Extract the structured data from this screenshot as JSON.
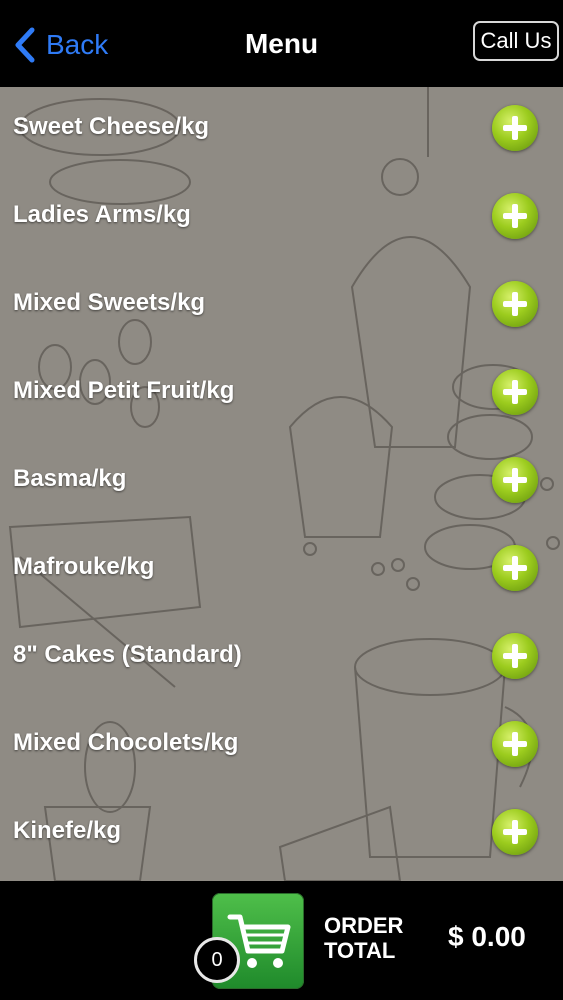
{
  "nav": {
    "back_label": "Back",
    "title": "Menu",
    "call_label": "Call Us"
  },
  "menu": {
    "items": [
      {
        "label": "Sweet Cheese/kg"
      },
      {
        "label": "Ladies Arms/kg"
      },
      {
        "label": "Mixed Sweets/kg"
      },
      {
        "label": "Mixed Petit Fruit/kg"
      },
      {
        "label": "Basma/kg"
      },
      {
        "label": "Mafrouke/kg"
      },
      {
        "label": "8\" Cakes (Standard)"
      },
      {
        "label": "Mixed Chocolets/kg"
      },
      {
        "label": "Kinefe/kg"
      }
    ],
    "add_icon": "plus-circle-icon"
  },
  "footer": {
    "cart_count": "0",
    "order_total_line1": "ORDER",
    "order_total_line2": "TOTAL",
    "total_value": "$ 0.00",
    "cart_icon": "shopping-cart-icon"
  },
  "colors": {
    "accent_blue": "#2f7bf6",
    "add_green": "#9ccc1e",
    "cart_green": "#3aa83d",
    "background_sketch": "#8f8b84"
  }
}
